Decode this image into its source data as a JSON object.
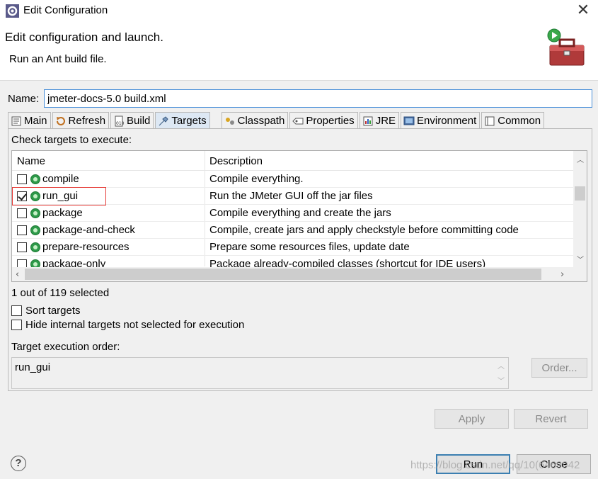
{
  "window": {
    "title": "Edit Configuration",
    "close_glyph": "✕"
  },
  "header": {
    "title": "Edit configuration and launch.",
    "description": "Run an Ant build file."
  },
  "name_field": {
    "label": "Name:",
    "value": "jmeter-docs-5.0 build.xml"
  },
  "tabs": [
    {
      "label": "Main",
      "icon": "main-tab-icon"
    },
    {
      "label": "Refresh",
      "icon": "refresh-icon"
    },
    {
      "label": "Build",
      "icon": "build-icon"
    },
    {
      "label": "Targets",
      "icon": "targets-icon",
      "active": true
    },
    {
      "label": "Classpath",
      "icon": "classpath-icon"
    },
    {
      "label": "Properties",
      "icon": "properties-icon"
    },
    {
      "label": "JRE",
      "icon": "jre-icon"
    },
    {
      "label": "Environment",
      "icon": "environment-icon"
    },
    {
      "label": "Common",
      "icon": "common-icon"
    }
  ],
  "targets": {
    "heading": "Check targets to execute:",
    "columns": [
      "Name",
      "Description"
    ],
    "rows": [
      {
        "name": "compile",
        "description": "Compile everything.",
        "checked": false
      },
      {
        "name": "run_gui",
        "description": "Run the JMeter GUI off the jar files",
        "checked": true
      },
      {
        "name": "package",
        "description": "Compile everything and create the jars",
        "checked": false
      },
      {
        "name": "package-and-check",
        "description": "Compile, create jars and apply checkstyle before committing code",
        "checked": false
      },
      {
        "name": "prepare-resources",
        "description": "Prepare some resources files, update date",
        "checked": false
      },
      {
        "name": "package-only",
        "description": "Package already-compiled classes (shortcut for IDE users)",
        "checked": false
      }
    ],
    "selected_count": "1 out of 119 selected"
  },
  "options": {
    "sort_targets": "Sort targets",
    "hide_internal": "Hide internal targets not selected for execution"
  },
  "execution_order": {
    "label": "Target execution order:",
    "value": "run_gui",
    "order_button": "Order..."
  },
  "buttons": {
    "apply": "Apply",
    "revert": "Revert",
    "run": "Run",
    "close": "Close",
    "help": "?"
  },
  "watermark": "https://blog.csdn.net/qq/10(6469942",
  "colors": {
    "accent": "#3c7fb1",
    "highlight_box": "#e53935",
    "target_dot": "#2e9a4a"
  }
}
